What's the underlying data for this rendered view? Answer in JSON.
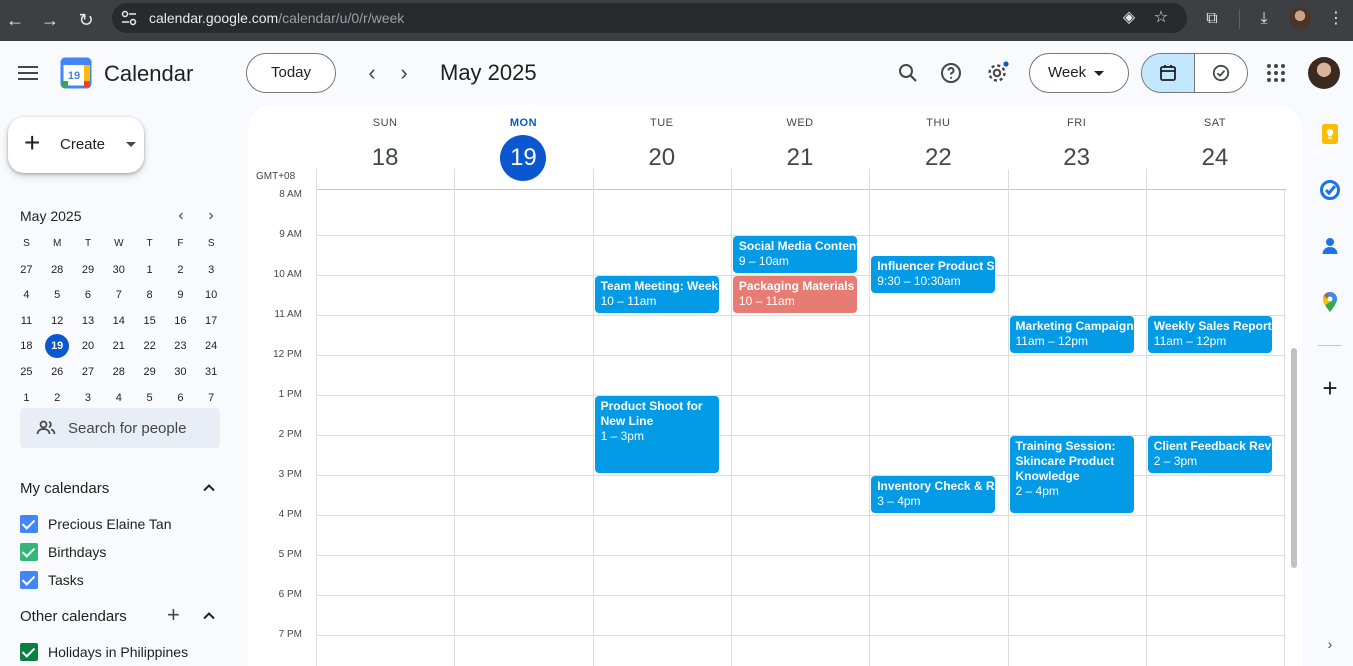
{
  "browser": {
    "url_host": "calendar.google.com",
    "url_path": "/calendar/u/0/r/week"
  },
  "header": {
    "app_name": "Calendar",
    "logo_day": "19",
    "today_label": "Today",
    "period": "May 2025",
    "view_label": "Week"
  },
  "sidebar": {
    "create_label": "Create",
    "mini_calendar": {
      "title": "May 2025",
      "weekdays": [
        "S",
        "M",
        "T",
        "W",
        "T",
        "F",
        "S"
      ],
      "weeks": [
        [
          "27",
          "28",
          "29",
          "30",
          "1",
          "2",
          "3"
        ],
        [
          "4",
          "5",
          "6",
          "7",
          "8",
          "9",
          "10"
        ],
        [
          "11",
          "12",
          "13",
          "14",
          "15",
          "16",
          "17"
        ],
        [
          "18",
          "19",
          "20",
          "21",
          "22",
          "23",
          "24"
        ],
        [
          "25",
          "26",
          "27",
          "28",
          "29",
          "30",
          "31"
        ],
        [
          "1",
          "2",
          "3",
          "4",
          "5",
          "6",
          "7"
        ]
      ],
      "selected": "19"
    },
    "search_people_placeholder": "Search for people",
    "my_calendars_title": "My calendars",
    "my_calendars": [
      {
        "name": "Precious Elaine Tan",
        "color": "#4285f4"
      },
      {
        "name": "Birthdays",
        "color": "#33b679"
      },
      {
        "name": "Tasks",
        "color": "#4285f4"
      }
    ],
    "other_calendars_title": "Other calendars",
    "other_calendars": [
      {
        "name": "Holidays in Philippines",
        "color": "#0b8043"
      }
    ]
  },
  "grid": {
    "timezone": "GMT+08",
    "days": [
      {
        "dow": "SUN",
        "num": "18",
        "today": false
      },
      {
        "dow": "MON",
        "num": "19",
        "today": true
      },
      {
        "dow": "TUE",
        "num": "20",
        "today": false
      },
      {
        "dow": "WED",
        "num": "21",
        "today": false
      },
      {
        "dow": "THU",
        "num": "22",
        "today": false
      },
      {
        "dow": "FRI",
        "num": "23",
        "today": false
      },
      {
        "dow": "SAT",
        "num": "24",
        "today": false
      }
    ],
    "hours": [
      "8 AM",
      "9 AM",
      "10 AM",
      "11 AM",
      "12 PM",
      "1 PM",
      "2 PM",
      "3 PM",
      "4 PM",
      "5 PM",
      "6 PM",
      "7 PM"
    ],
    "events": [
      {
        "title": "Team Meeting: Week",
        "time": "10 – 11am",
        "day": 2,
        "start": 10,
        "end": 11,
        "color": "#039be5"
      },
      {
        "title": "Product Shoot for New Line",
        "time": "1 – 3pm",
        "day": 2,
        "start": 13,
        "end": 15,
        "color": "#039be5"
      },
      {
        "title": "Social Media Content",
        "time": "9 – 10am",
        "day": 3,
        "start": 9,
        "end": 10,
        "color": "#039be5"
      },
      {
        "title": "Packaging Materials",
        "time": "10 – 11am",
        "day": 3,
        "start": 10,
        "end": 11,
        "color": "#e67c73"
      },
      {
        "title": "Influencer Product S",
        "time": "9:30 – 10:30am",
        "day": 4,
        "start": 9.5,
        "end": 10.5,
        "color": "#039be5"
      },
      {
        "title": "Inventory Check & Re",
        "time": "3 – 4pm",
        "day": 4,
        "start": 15,
        "end": 16,
        "color": "#039be5"
      },
      {
        "title": "Marketing Campaign",
        "time": "11am – 12pm",
        "day": 5,
        "start": 11,
        "end": 12,
        "color": "#039be5"
      },
      {
        "title": "Training Session: Skincare Product Knowledge",
        "time": "2 – 4pm",
        "day": 5,
        "start": 14,
        "end": 16,
        "color": "#039be5"
      },
      {
        "title": "Weekly Sales Report",
        "time": "11am – 12pm",
        "day": 6,
        "start": 11,
        "end": 12,
        "color": "#039be5"
      },
      {
        "title": "Client Feedback Revi",
        "time": "2 – 3pm",
        "day": 6,
        "start": 14,
        "end": 15,
        "color": "#039be5"
      }
    ]
  },
  "colors": {
    "accent": "#0b57d0",
    "event_blue": "#039be5",
    "event_flamingo": "#e67c73",
    "selected_view": "#c2e7ff"
  }
}
